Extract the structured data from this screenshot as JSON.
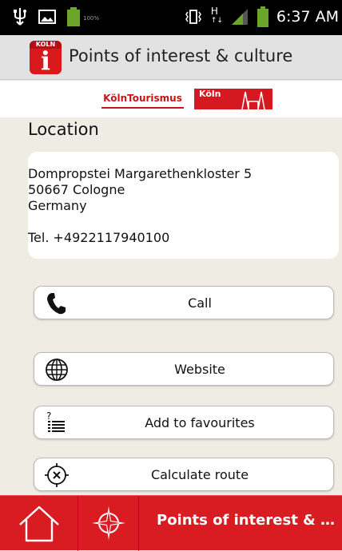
{
  "status_bar": {
    "time": "6:37 AM",
    "battery_text": "100%",
    "network_text": "H",
    "network_sub": "↑↓",
    "icons": [
      "usb-icon",
      "image-icon",
      "battery-icon",
      "vibrate-icon",
      "network-h-icon",
      "signal-icon",
      "battery-full-icon"
    ]
  },
  "action_bar": {
    "logo_text": "KOLN",
    "logo_letter": "i",
    "title": "Points of interest & culture"
  },
  "sponsors": {
    "koelntourismus": "KölnTourismus",
    "koeln": "Köln"
  },
  "location": {
    "title": "Location",
    "address_lines": [
      "Dompropstei Margarethenkloster 5",
      "50667 Cologne",
      "Germany"
    ],
    "phone": "Tel. +4922117940100"
  },
  "buttons": {
    "call": "Call",
    "website": "Website",
    "favourites": "Add to favourites",
    "route": "Calculate route"
  },
  "nav": {
    "title": "Points of interest & c..."
  },
  "colors": {
    "accent": "#d81c22",
    "background": "#efede3"
  }
}
